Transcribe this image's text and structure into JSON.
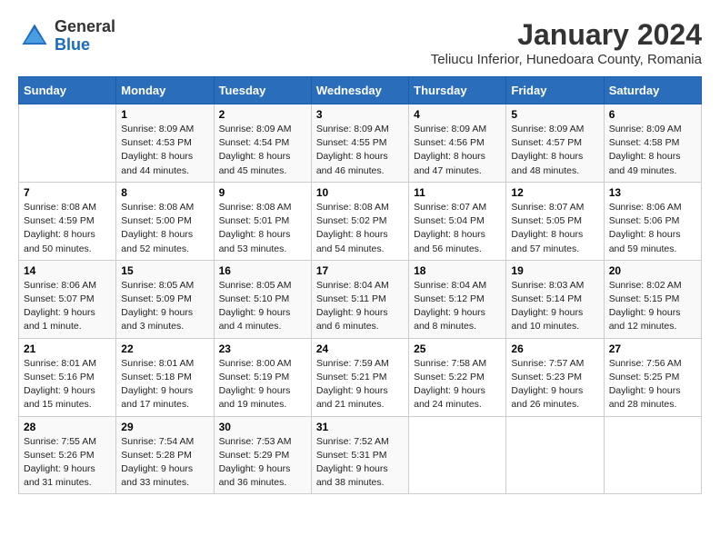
{
  "logo": {
    "general": "General",
    "blue": "Blue"
  },
  "title": "January 2024",
  "location": "Teliucu Inferior, Hunedoara County, Romania",
  "header": {
    "days": [
      "Sunday",
      "Monday",
      "Tuesday",
      "Wednesday",
      "Thursday",
      "Friday",
      "Saturday"
    ]
  },
  "weeks": [
    [
      {
        "day": "",
        "info": ""
      },
      {
        "day": "1",
        "info": "Sunrise: 8:09 AM\nSunset: 4:53 PM\nDaylight: 8 hours\nand 44 minutes."
      },
      {
        "day": "2",
        "info": "Sunrise: 8:09 AM\nSunset: 4:54 PM\nDaylight: 8 hours\nand 45 minutes."
      },
      {
        "day": "3",
        "info": "Sunrise: 8:09 AM\nSunset: 4:55 PM\nDaylight: 8 hours\nand 46 minutes."
      },
      {
        "day": "4",
        "info": "Sunrise: 8:09 AM\nSunset: 4:56 PM\nDaylight: 8 hours\nand 47 minutes."
      },
      {
        "day": "5",
        "info": "Sunrise: 8:09 AM\nSunset: 4:57 PM\nDaylight: 8 hours\nand 48 minutes."
      },
      {
        "day": "6",
        "info": "Sunrise: 8:09 AM\nSunset: 4:58 PM\nDaylight: 8 hours\nand 49 minutes."
      }
    ],
    [
      {
        "day": "7",
        "info": "Sunrise: 8:08 AM\nSunset: 4:59 PM\nDaylight: 8 hours\nand 50 minutes."
      },
      {
        "day": "8",
        "info": "Sunrise: 8:08 AM\nSunset: 5:00 PM\nDaylight: 8 hours\nand 52 minutes."
      },
      {
        "day": "9",
        "info": "Sunrise: 8:08 AM\nSunset: 5:01 PM\nDaylight: 8 hours\nand 53 minutes."
      },
      {
        "day": "10",
        "info": "Sunrise: 8:08 AM\nSunset: 5:02 PM\nDaylight: 8 hours\nand 54 minutes."
      },
      {
        "day": "11",
        "info": "Sunrise: 8:07 AM\nSunset: 5:04 PM\nDaylight: 8 hours\nand 56 minutes."
      },
      {
        "day": "12",
        "info": "Sunrise: 8:07 AM\nSunset: 5:05 PM\nDaylight: 8 hours\nand 57 minutes."
      },
      {
        "day": "13",
        "info": "Sunrise: 8:06 AM\nSunset: 5:06 PM\nDaylight: 8 hours\nand 59 minutes."
      }
    ],
    [
      {
        "day": "14",
        "info": "Sunrise: 8:06 AM\nSunset: 5:07 PM\nDaylight: 9 hours\nand 1 minute."
      },
      {
        "day": "15",
        "info": "Sunrise: 8:05 AM\nSunset: 5:09 PM\nDaylight: 9 hours\nand 3 minutes."
      },
      {
        "day": "16",
        "info": "Sunrise: 8:05 AM\nSunset: 5:10 PM\nDaylight: 9 hours\nand 4 minutes."
      },
      {
        "day": "17",
        "info": "Sunrise: 8:04 AM\nSunset: 5:11 PM\nDaylight: 9 hours\nand 6 minutes."
      },
      {
        "day": "18",
        "info": "Sunrise: 8:04 AM\nSunset: 5:12 PM\nDaylight: 9 hours\nand 8 minutes."
      },
      {
        "day": "19",
        "info": "Sunrise: 8:03 AM\nSunset: 5:14 PM\nDaylight: 9 hours\nand 10 minutes."
      },
      {
        "day": "20",
        "info": "Sunrise: 8:02 AM\nSunset: 5:15 PM\nDaylight: 9 hours\nand 12 minutes."
      }
    ],
    [
      {
        "day": "21",
        "info": "Sunrise: 8:01 AM\nSunset: 5:16 PM\nDaylight: 9 hours\nand 15 minutes."
      },
      {
        "day": "22",
        "info": "Sunrise: 8:01 AM\nSunset: 5:18 PM\nDaylight: 9 hours\nand 17 minutes."
      },
      {
        "day": "23",
        "info": "Sunrise: 8:00 AM\nSunset: 5:19 PM\nDaylight: 9 hours\nand 19 minutes."
      },
      {
        "day": "24",
        "info": "Sunrise: 7:59 AM\nSunset: 5:21 PM\nDaylight: 9 hours\nand 21 minutes."
      },
      {
        "day": "25",
        "info": "Sunrise: 7:58 AM\nSunset: 5:22 PM\nDaylight: 9 hours\nand 24 minutes."
      },
      {
        "day": "26",
        "info": "Sunrise: 7:57 AM\nSunset: 5:23 PM\nDaylight: 9 hours\nand 26 minutes."
      },
      {
        "day": "27",
        "info": "Sunrise: 7:56 AM\nSunset: 5:25 PM\nDaylight: 9 hours\nand 28 minutes."
      }
    ],
    [
      {
        "day": "28",
        "info": "Sunrise: 7:55 AM\nSunset: 5:26 PM\nDaylight: 9 hours\nand 31 minutes."
      },
      {
        "day": "29",
        "info": "Sunrise: 7:54 AM\nSunset: 5:28 PM\nDaylight: 9 hours\nand 33 minutes."
      },
      {
        "day": "30",
        "info": "Sunrise: 7:53 AM\nSunset: 5:29 PM\nDaylight: 9 hours\nand 36 minutes."
      },
      {
        "day": "31",
        "info": "Sunrise: 7:52 AM\nSunset: 5:31 PM\nDaylight: 9 hours\nand 38 minutes."
      },
      {
        "day": "",
        "info": ""
      },
      {
        "day": "",
        "info": ""
      },
      {
        "day": "",
        "info": ""
      }
    ]
  ]
}
